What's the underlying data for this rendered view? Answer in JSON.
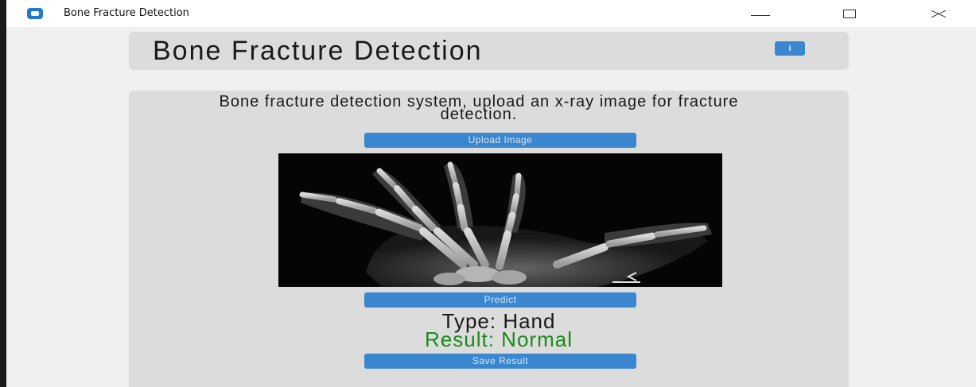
{
  "window": {
    "title": "Bone Fracture Detection",
    "icon": "app-window-icon"
  },
  "header": {
    "title": "Bone Fracture Detection",
    "info_icon": "info-icon",
    "info_glyph": "i"
  },
  "main": {
    "description": "Bone fracture detection system, upload an x-ray image for fracture detection.",
    "upload_label": "Upload Image",
    "predict_label": "Predict",
    "type_text": "Type: Hand",
    "result_text": "Result: Normal",
    "save_label": "Save Result"
  },
  "colors": {
    "button": "#3a87d0",
    "card": "#dcdcdc",
    "result_normal": "#1a8a1a",
    "window_bg": "#f0f0f0"
  }
}
